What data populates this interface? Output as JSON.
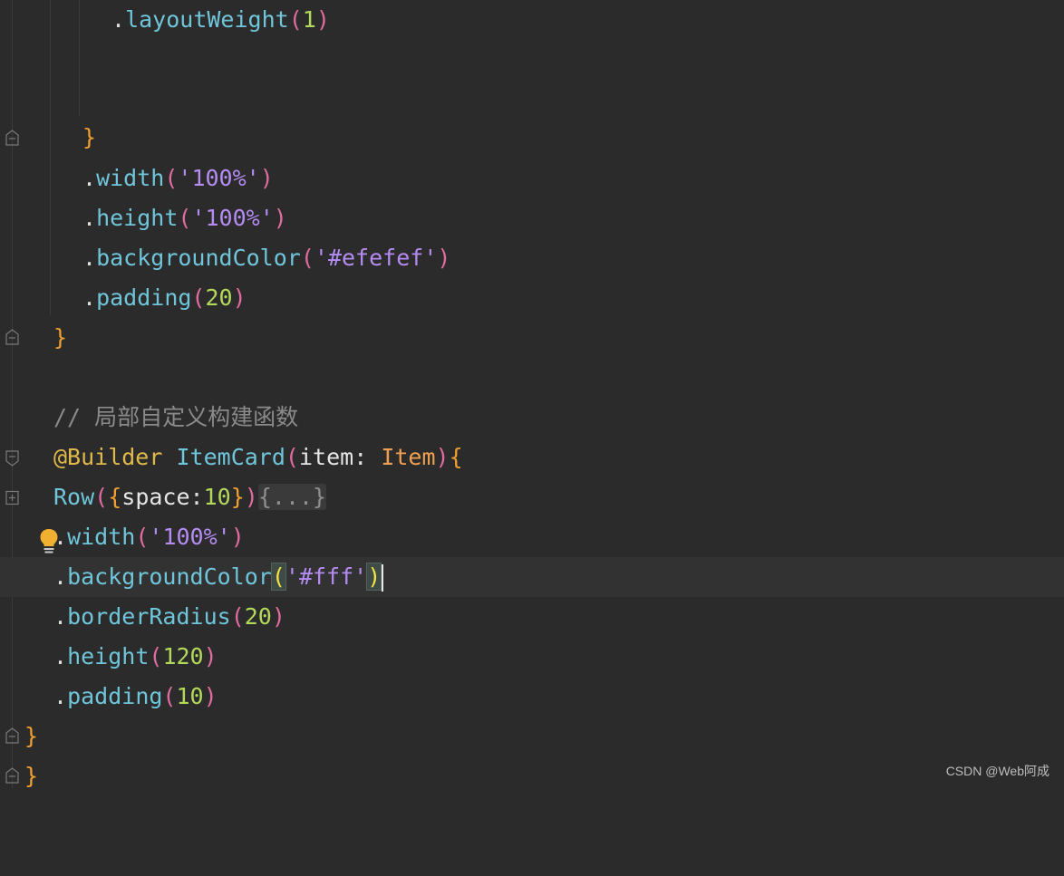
{
  "editor": {
    "lines": [
      {
        "dot": ".",
        "method": "layoutWeight",
        "open": "(",
        "num": "1",
        "close": ")"
      },
      {
        "brace": "}"
      },
      {
        "dot": ".",
        "method": "width",
        "open": "(",
        "str": "'100%'",
        "close": ")"
      },
      {
        "dot": ".",
        "method": "height",
        "open": "(",
        "str": "'100%'",
        "close": ")"
      },
      {
        "dot": ".",
        "method": "backgroundColor",
        "open": "(",
        "str": "'#efefef'",
        "close": ")"
      },
      {
        "dot": ".",
        "method": "padding",
        "open": "(",
        "num": "20",
        "close": ")"
      },
      {
        "brace": "}"
      },
      {
        "comment": "// 局部自定义构建函数"
      },
      {
        "decorator": "@Builder",
        "fn": "ItemCard",
        "open": "(",
        "param": "item",
        "colon": ":",
        "type": "Item",
        "close": ")",
        "brace": "{"
      },
      {
        "component": "Row",
        "open": "(",
        "brace_open": "{",
        "key": "space",
        "colon": ":",
        "num": "10",
        "brace_close": "}",
        "close": ")",
        "folded": "{...}"
      },
      {
        "dot": ".",
        "method": "width",
        "open": "(",
        "str": "'100%'",
        "close": ")"
      },
      {
        "dot": ".",
        "method": "backgroundColor",
        "open": "(",
        "str": "'#fff'",
        "close": ")"
      },
      {
        "dot": ".",
        "method": "borderRadius",
        "open": "(",
        "num": "20",
        "close": ")"
      },
      {
        "dot": ".",
        "method": "height",
        "open": "(",
        "num": "120",
        "close": ")"
      },
      {
        "dot": ".",
        "method": "padding",
        "open": "(",
        "num": "10",
        "close": ")"
      },
      {
        "brace": "}"
      },
      {
        "brace": "}"
      }
    ]
  },
  "watermark": "CSDN @Web阿成",
  "colors": {
    "background": "#2b2b2b",
    "method": "#6fc5d9",
    "string": "#b58cf2",
    "number": "#b3d95c",
    "paren": "#e06c9f",
    "brace": "#f0a030",
    "comment": "#8a8a8a"
  },
  "icons": [
    "fold-collapse-icon",
    "fold-expand-icon",
    "fold-end-icon",
    "lightbulb-icon"
  ]
}
